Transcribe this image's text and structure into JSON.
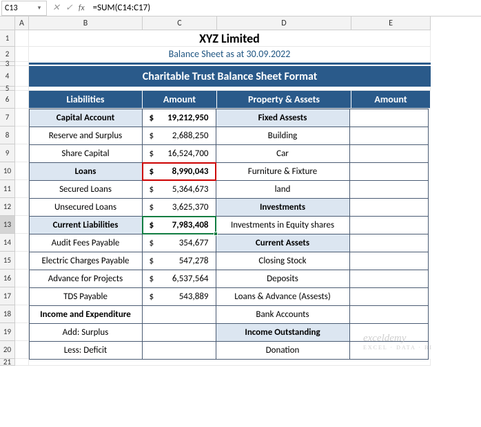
{
  "formula_bar": {
    "name_box": "C13",
    "formula": "=SUM(C14:C17)"
  },
  "columns": [
    "A",
    "B",
    "C",
    "D",
    "E"
  ],
  "row_numbers": [
    "1",
    "2",
    "3",
    "4",
    "5",
    "6",
    "7",
    "8",
    "9",
    "10",
    "11",
    "12",
    "13",
    "14",
    "15",
    "16",
    "17",
    "18",
    "19",
    "20",
    "21"
  ],
  "company": "XYZ Limited",
  "subtitle": "Balance Sheet as at 30.09.2022",
  "banner": "Charitable Trust Balance Sheet Format",
  "headers": {
    "liab": "Liabilities",
    "amt1": "Amount",
    "assets": "Property & Assets",
    "amt2": "Amount"
  },
  "rows": [
    {
      "b": "Capital Account",
      "c_sym": "$",
      "c_val": "19,212,950",
      "d": "Fixed Assests",
      "b_lb": true,
      "d_lb": true
    },
    {
      "b": "Reserve and Surplus",
      "c_sym": "$",
      "c_val": "2,688,250",
      "d": "Building"
    },
    {
      "b": "Share Capital",
      "c_sym": "$",
      "c_val": "16,524,700",
      "d": "Car"
    },
    {
      "b": "Loans",
      "c_sym": "$",
      "c_val": "8,990,043",
      "d": "Furniture & Fixture",
      "b_lb": true,
      "red": true
    },
    {
      "b": "Secured Loans",
      "c_sym": "$",
      "c_val": "5,364,673",
      "d": "land"
    },
    {
      "b": "Unsecured Loans",
      "c_sym": "$",
      "c_val": "3,625,370",
      "d": "Investments",
      "d_lb": true
    },
    {
      "b": "Current Liabilities",
      "c_sym": "$",
      "c_val": "7,983,408",
      "d": "Investments in Equity shares",
      "b_lb": true,
      "red": true,
      "sel": true
    },
    {
      "b": "Audit Fees Payable",
      "c_sym": "$",
      "c_val": "354,677",
      "d": "Current Assets",
      "d_lb": true
    },
    {
      "b": "Electric Charges Payable",
      "c_sym": "$",
      "c_val": "547,278",
      "d": "Closing Stock"
    },
    {
      "b": "Advance for Projects",
      "c_sym": "$",
      "c_val": "6,537,564",
      "d": "Deposits"
    },
    {
      "b": "TDS Payable",
      "c_sym": "$",
      "c_val": "543,889",
      "d": "Loans & Advance (Assests)"
    },
    {
      "b": "Income and Expenditure",
      "c_sym": "",
      "c_val": "",
      "d": "Bank Accounts",
      "b_bold": true
    },
    {
      "b": "Add: Surplus",
      "c_sym": "",
      "c_val": "",
      "d": "Income Outstanding",
      "d_lb": true
    },
    {
      "b": "Less: Deficit",
      "c_sym": "",
      "c_val": "",
      "d": "Donation"
    }
  ],
  "watermark": {
    "main": "exceldemy",
    "sub": "EXCEL · DATA · BI"
  },
  "chart_data": {
    "type": "table",
    "title": "Charitable Trust Balance Sheet Format",
    "company": "XYZ Limited",
    "as_at": "30.09.2022",
    "columns": [
      "Liabilities",
      "Amount",
      "Property & Assets",
      "Amount"
    ],
    "rows": [
      [
        "Capital Account",
        19212950,
        "Fixed Assests",
        null
      ],
      [
        "Reserve and Surplus",
        2688250,
        "Building",
        null
      ],
      [
        "Share Capital",
        16524700,
        "Car",
        null
      ],
      [
        "Loans",
        8990043,
        "Furniture & Fixture",
        null
      ],
      [
        "Secured Loans",
        5364673,
        "land",
        null
      ],
      [
        "Unsecured Loans",
        3625370,
        "Investments",
        null
      ],
      [
        "Current Liabilities",
        7983408,
        "Investments in Equity shares",
        null
      ],
      [
        "Audit Fees Payable",
        354677,
        "Current Assets",
        null
      ],
      [
        "Electric Charges Payable",
        547278,
        "Closing Stock",
        null
      ],
      [
        "Advance for Projects",
        6537564,
        "Deposits",
        null
      ],
      [
        "TDS Payable",
        543889,
        "Loans & Advance (Assests)",
        null
      ],
      [
        "Income and Expenditure",
        null,
        "Bank Accounts",
        null
      ],
      [
        "Add: Surplus",
        null,
        "Income Outstanding",
        null
      ],
      [
        "Less: Deficit",
        null,
        "Donation",
        null
      ]
    ]
  }
}
